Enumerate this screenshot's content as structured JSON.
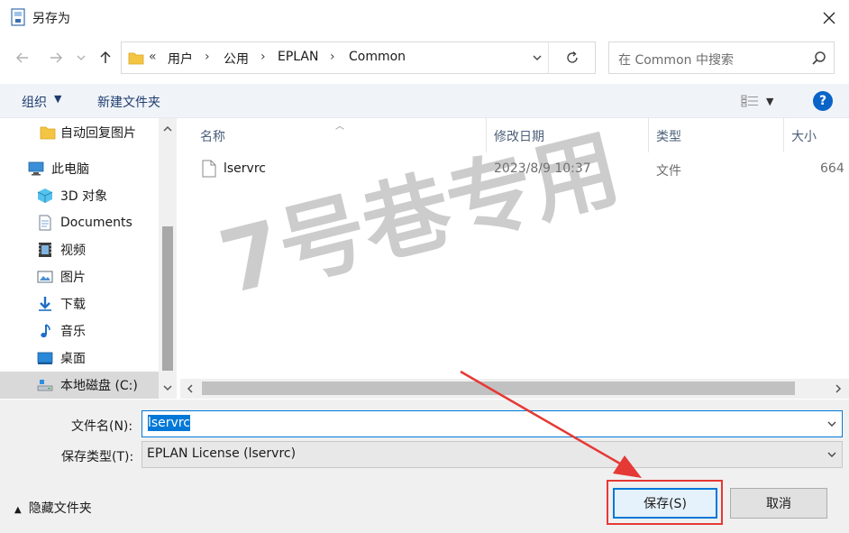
{
  "window": {
    "title": "另存为"
  },
  "address": {
    "overflow": "«",
    "crumbs": [
      "用户",
      "公用",
      "EPLAN",
      "Common"
    ],
    "separator": "›"
  },
  "search": {
    "placeholder": "在 Common 中搜索"
  },
  "toolbar": {
    "organize": "组织",
    "new_folder": "新建文件夹",
    "help": "?"
  },
  "nav": {
    "items": [
      {
        "label": "自动回复图片",
        "icon": "folder-icon"
      },
      {
        "label": "此电脑",
        "icon": "computer-icon"
      },
      {
        "label": "3D 对象",
        "icon": "cube-icon"
      },
      {
        "label": "Documents",
        "icon": "document-icon"
      },
      {
        "label": "视频",
        "icon": "video-icon"
      },
      {
        "label": "图片",
        "icon": "picture-icon"
      },
      {
        "label": "下载",
        "icon": "download-icon"
      },
      {
        "label": "音乐",
        "icon": "music-icon"
      },
      {
        "label": "桌面",
        "icon": "desktop-icon"
      },
      {
        "label": "本地磁盘 (C:)",
        "icon": "drive-icon"
      }
    ]
  },
  "filelist": {
    "columns": [
      "名称",
      "修改日期",
      "类型",
      "大小"
    ],
    "rows": [
      {
        "name": "lservrc",
        "modified": "2023/8/9 10:37",
        "type": "文件",
        "size": "664"
      }
    ]
  },
  "form": {
    "filename_label": "文件名(N):",
    "filename_value": "lservrc",
    "filetype_label": "保存类型(T):",
    "filetype_value": "EPLAN License (lservrc)"
  },
  "footer": {
    "hide_folders": "隐藏文件夹",
    "save": "保存(S)",
    "cancel": "取消"
  },
  "watermark": "7号巷专用",
  "colors": {
    "accent": "#0078d7",
    "annotation": "#e53935",
    "help": "#0a64c8"
  }
}
